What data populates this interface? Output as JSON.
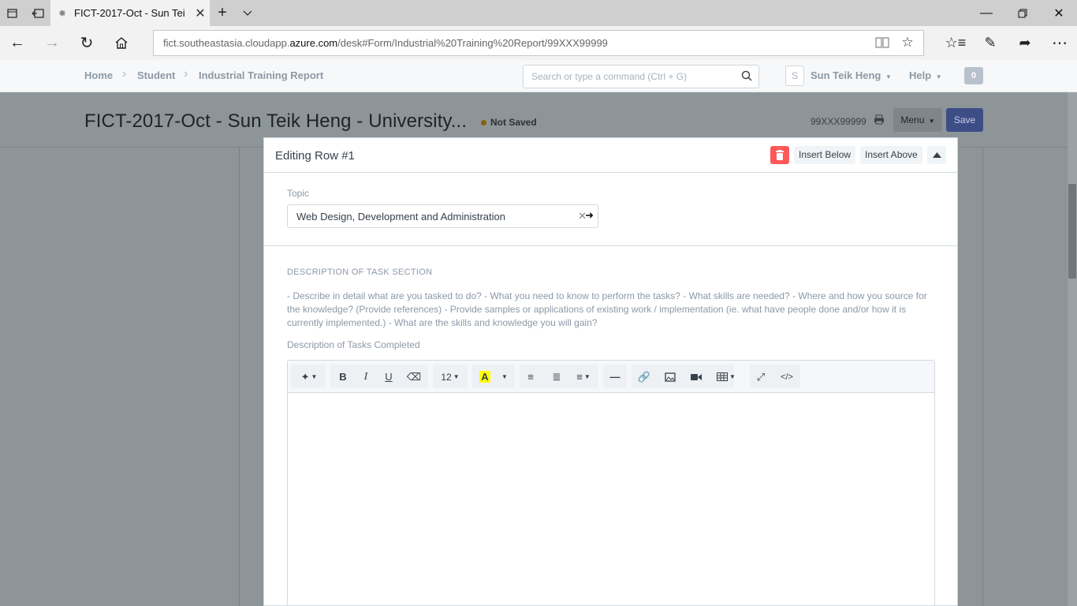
{
  "browser": {
    "tab_title": "FICT-2017-Oct - Sun Tei",
    "url_prefix": "fict.southeastasia.cloudapp.",
    "url_host": "azure.com",
    "url_path": "/desk#Form/Industrial%20Training%20Report/99XXX99999"
  },
  "navbar": {
    "breadcrumbs": [
      "Home",
      "Student",
      "Industrial Training Report"
    ],
    "search_placeholder": "Search or type a command (Ctrl + G)",
    "avatar_initial": "S",
    "user_name": "Sun Teik Heng",
    "help_label": "Help",
    "notification_count": "0"
  },
  "page": {
    "title": "FICT-2017-Oct - Sun Teik Heng - University...",
    "status": "Not Saved",
    "doc_name": "99XXX99999",
    "menu_label": "Menu",
    "save_label": "Save"
  },
  "grid_form": {
    "title": "Editing Row #1",
    "insert_below": "Insert Below",
    "insert_above": "Insert Above",
    "topic_label": "Topic",
    "topic_value": "Web Design, Development and Administration",
    "section_heading": "DESCRIPTION OF TASK SECTION",
    "section_description": "- Describe in detail what are you tasked to do? - What you need to know to perform the tasks? - What skills are needed? - Where and how you source for the knowledge? (Provide references) - Provide samples or applications of existing work / implementation (ie. what have people done and/or how it is currently implemented.) - What are the skills and knowledge you will gain?",
    "field_label": "Description of Tasks Completed",
    "font_size": "12"
  },
  "colors": {
    "delete": "#ff5858",
    "primary_dimmed": "#3d4d86",
    "overlay_bg": "#8d9599"
  }
}
